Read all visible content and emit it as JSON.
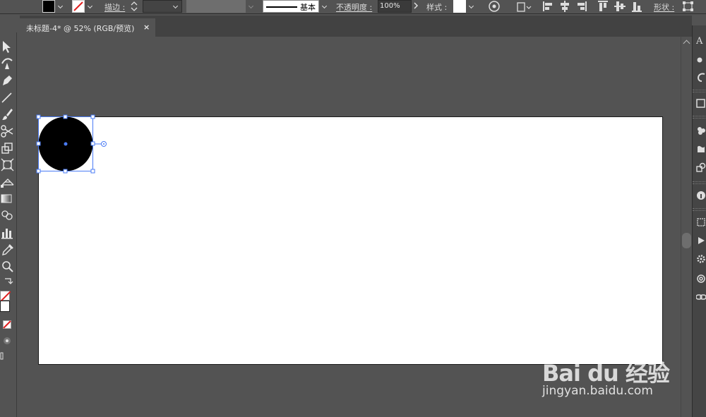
{
  "control_bar": {
    "stroke_label": "描边 :",
    "brush_label": "基本",
    "opacity_label": "不透明度 :",
    "opacity_value": "100%",
    "style_label": "样式 :",
    "shape_label": "形状 :"
  },
  "document": {
    "tab_title": "未标题-4* @ 52% (RGB/预览)",
    "close_glyph": "×"
  },
  "colors": {
    "fill": "#000000",
    "stroke": "none",
    "selection": "#4a7bf5",
    "artboard": "#ffffff"
  },
  "right_panel": {
    "icons": [
      "character-icon",
      "circle-dot-icon",
      "glyph-icon",
      "rectangle-icon",
      "swatches-icon",
      "brushes-icon",
      "symbols-icon",
      "info-icon",
      "transform-icon",
      "actions-icon",
      "gear-icon",
      "links-icon",
      "chain-icon"
    ]
  },
  "watermark": {
    "brand": "Bai du 经验",
    "url": "jingyan.baidu.com"
  }
}
